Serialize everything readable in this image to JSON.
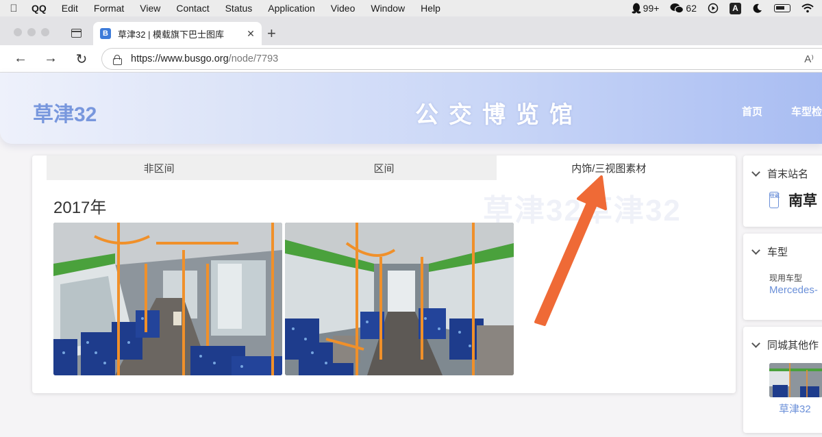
{
  "menubar": {
    "app": "QQ",
    "items": [
      "Edit",
      "Format",
      "View",
      "Contact",
      "Status",
      "Application",
      "Video",
      "Window",
      "Help"
    ],
    "status": {
      "qq_count": "99+",
      "wechat_count": "62",
      "input_method": "A"
    }
  },
  "browser": {
    "tab_title": "草津32 | 模载旗下巴士图库",
    "favicon_letter": "B",
    "url_host": "https://www.busgo.org",
    "url_path": "/node/7793",
    "read_aloud": "A⁾"
  },
  "site": {
    "logo": "草津32",
    "title": "公交博览馆",
    "nav": [
      "首页",
      "车型检"
    ]
  },
  "main": {
    "tabs": [
      "非区间",
      "区间",
      "内饰/三视图素材"
    ],
    "active_tab": 2,
    "watermark": "草津32草津32",
    "year_heading": "2017年"
  },
  "sidebar": {
    "stops": {
      "title": "首末站名",
      "direction_icon": "往返",
      "name": "南草"
    },
    "model": {
      "title": "车型",
      "label": "现用车型",
      "value": "Mercedes-"
    },
    "others": {
      "title": "同城其他作",
      "caption": "草津32"
    }
  },
  "colors": {
    "accent": "#6a8fd8",
    "annotation_arrow": "#ef6a36",
    "bus_pole": "#f0902a",
    "bus_green": "#4aa13c",
    "seat_blue": "#1e3c8c"
  }
}
